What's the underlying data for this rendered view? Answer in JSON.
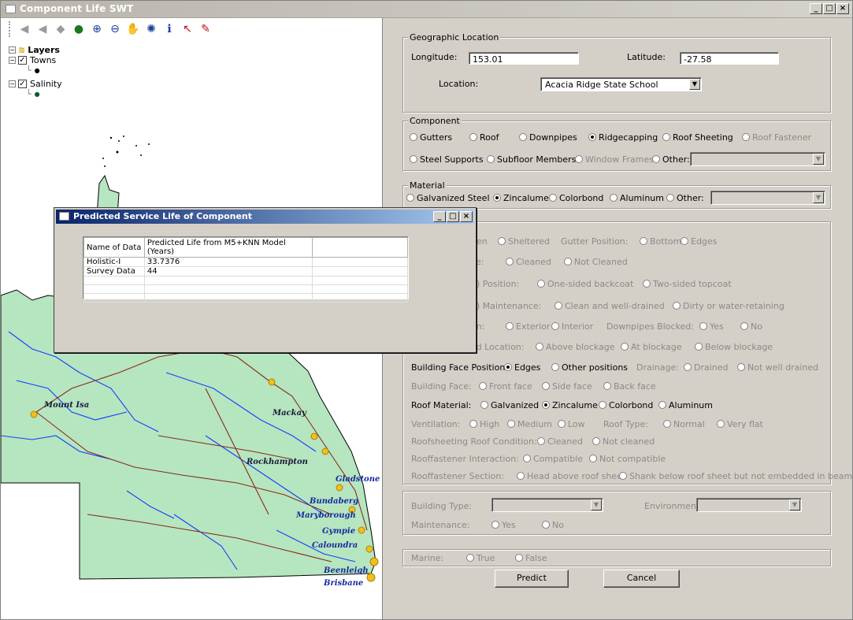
{
  "window": {
    "title": "Component Life SWT"
  },
  "toolbar": {
    "icons": [
      "back-icon",
      "forward-icon",
      "home-icon",
      "globe-icon",
      "zoom-in-icon",
      "zoom-out-icon",
      "pan-hand-icon",
      "refresh-icon",
      "info-icon",
      "select-arrow-icon",
      "edit-icon"
    ]
  },
  "layers": {
    "title": "Layers",
    "items": [
      {
        "label": "Towns",
        "checked": true
      },
      {
        "label": "Salinity",
        "checked": true
      }
    ]
  },
  "map": {
    "towns": [
      "Mount Isa",
      "Mackay",
      "Rockhampton",
      "Gladstone",
      "Bundaberg",
      "Maryborough",
      "Gympie",
      "Caloundra",
      "Beenleigh",
      "Brisbane"
    ]
  },
  "geo": {
    "title": "Geographic Location",
    "longitude_label": "Longitude:",
    "longitude": "153.01",
    "latitude_label": "Latitude:",
    "latitude": "-27.58",
    "location_label": "Location:",
    "location": "Acacia Ridge State School"
  },
  "component": {
    "title": "Component",
    "row1": [
      "Gutters",
      "Roof",
      "Downpipes",
      "Ridgecapping",
      "Roof Sheeting",
      "Roof Fastener"
    ],
    "row2": [
      "Steel Supports",
      "Subfloor Members",
      "Window Frames",
      "Other:"
    ],
    "selected": "Ridgecapping"
  },
  "material": {
    "title": "Material",
    "options": [
      "Galvanized Steel",
      "Zincalume",
      "Colorbond",
      "Aluminum",
      "Other:"
    ],
    "selected": "Zincalume"
  },
  "props": {
    "r1": {
      "label": "pen",
      "a": "Sheltered",
      "l2": "Gutter Position:",
      "b": "Bottom",
      "c": "Edges"
    },
    "r2": {
      "label": "ce:",
      "a": "Cleaned",
      "b": "Not Cleaned"
    },
    "r3": {
      "label": "d) Position:",
      "a": "One-sided backcoat",
      "b": "Two-sided topcoat"
    },
    "r4": {
      "label": "d) Maintenance:",
      "a": "Clean and well-drained",
      "b": "Dirty or water-retaining"
    },
    "r5": {
      "label": "on:",
      "a": "Exterior",
      "b": "Interior",
      "l2": "Downpipes Blocked:",
      "c": "Yes",
      "d": "No"
    },
    "r6": {
      "label": "ed Location:",
      "a": "Above blockage",
      "b": "At blockage",
      "c": "Below blockage"
    },
    "r7": {
      "label": "Building Face Position:",
      "a": "Edges",
      "b": "Other positions",
      "l2": "Drainage:",
      "c": "Drained",
      "d": "Not well drained"
    },
    "r8": {
      "label": "Building Face:",
      "a": "Front face",
      "b": "Side face",
      "c": "Back face"
    },
    "r9": {
      "label": "Roof Material:",
      "a": "Galvanized",
      "b": "Zincalume",
      "c": "Colorbond",
      "d": "Aluminum"
    },
    "r10": {
      "label": "Ventilation:",
      "a": "High",
      "b": "Medium",
      "c": "Low",
      "l2": "Roof Type:",
      "d": "Normal",
      "e": "Very flat"
    },
    "r11": {
      "label": "Roofsheeting Roof Condition:",
      "a": "Cleaned",
      "b": "Not cleaned"
    },
    "r12": {
      "label": "Rooffastener Interaction:",
      "a": "Compatible",
      "b": "Not compatible"
    },
    "r13": {
      "label": "Rooffastener Section:",
      "a": "Head above roof sheet",
      "b": "Shank below roof sheet but not embedded in beam"
    }
  },
  "building": {
    "type_label": "Building Type:",
    "env_label": "Environment:",
    "maint_label": "Maintenance:",
    "yes": "Yes",
    "no": "No"
  },
  "marine": {
    "label": "Marine:",
    "true": "True",
    "false": "False"
  },
  "buttons": {
    "predict": "Predict",
    "cancel": "Cancel"
  },
  "dialog": {
    "title": "Predicted Service Life of Component",
    "columns": [
      "Name of Data",
      "Predicted Life from M5+KNN Model (Years)"
    ],
    "rows": [
      [
        "Holistic-I",
        "33.7376"
      ],
      [
        "Survey Data",
        "44"
      ]
    ]
  },
  "colors": {
    "land": "#b5e6c0",
    "river": "#1a3cff",
    "road": "#8b2a1a",
    "town": "#f0c020"
  }
}
